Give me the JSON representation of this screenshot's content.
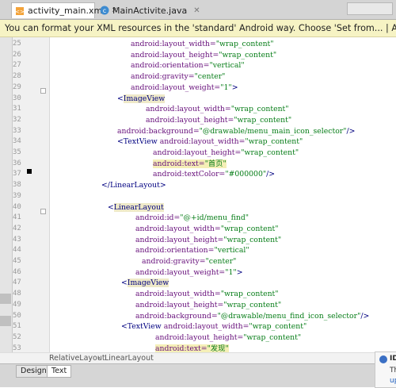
{
  "tabs": [
    {
      "label": "activity_main.xml",
      "icon": "xml-file-icon",
      "active": true
    },
    {
      "label": "MainActivite.java",
      "icon": "java-class-icon",
      "active": false
    }
  ],
  "notice": "You can format your XML resources in the 'standard' Android way. Choose 'Set from... | Android' in the XML code styl...",
  "lines": [
    {
      "n": "25",
      "indent": 165,
      "parts": [
        [
          "attr",
          "android:layout_width="
        ],
        [
          "val",
          "\"wrap_content\""
        ]
      ]
    },
    {
      "n": "26",
      "indent": 165,
      "parts": [
        [
          "attr",
          "android:layout_height="
        ],
        [
          "val",
          "\"wrap_content\""
        ]
      ]
    },
    {
      "n": "27",
      "indent": 165,
      "parts": [
        [
          "attr",
          "android:orientation="
        ],
        [
          "val",
          "\"vertical\""
        ]
      ]
    },
    {
      "n": "28",
      "indent": 165,
      "parts": [
        [
          "attr",
          "android:gravity="
        ],
        [
          "val",
          "\"center\""
        ]
      ]
    },
    {
      "n": "29",
      "indent": 165,
      "parts": [
        [
          "attr",
          "android:layout_weight="
        ],
        [
          "val",
          "\"1\""
        ],
        [
          "tag",
          ">"
        ]
      ]
    },
    {
      "n": "30",
      "indent": 148,
      "parts": [
        [
          "tag",
          "<"
        ],
        [
          "taghl",
          "ImageView"
        ]
      ]
    },
    {
      "n": "31",
      "indent": 184,
      "parts": [
        [
          "attr",
          "android:layout_width="
        ],
        [
          "val",
          "\"wrap_content\""
        ]
      ]
    },
    {
      "n": "32",
      "indent": 184,
      "parts": [
        [
          "attr",
          "android:layout_height="
        ],
        [
          "val",
          "\"wrap_content\""
        ]
      ]
    },
    {
      "n": "33",
      "indent": 148,
      "parts": [
        [
          "attr",
          "android:background="
        ],
        [
          "val",
          "\"@drawable/menu_main_icon_selector\""
        ],
        [
          "tag",
          "/>"
        ]
      ]
    },
    {
      "n": "34",
      "indent": 148,
      "parts": [
        [
          "tag",
          "<TextView "
        ],
        [
          "attr",
          "android:layout_width="
        ],
        [
          "val",
          "\"wrap_content\""
        ]
      ]
    },
    {
      "n": "35",
      "indent": 193,
      "parts": [
        [
          "attr",
          "android:layout_height="
        ],
        [
          "val",
          "\"wrap_content\""
        ]
      ]
    },
    {
      "n": "36",
      "indent": 193,
      "parts": [
        [
          "attrhl",
          "android:text="
        ],
        [
          "valhl",
          "\"首页\""
        ]
      ]
    },
    {
      "n": "37",
      "indent": 193,
      "parts": [
        [
          "attr",
          "android:textColor="
        ],
        [
          "val",
          "\"#000000\""
        ],
        [
          "tag",
          "/>"
        ]
      ]
    },
    {
      "n": "38",
      "indent": 128,
      "parts": [
        [
          "tag",
          "</"
        ],
        [
          "tag",
          "LinearLayout"
        ],
        [
          "tag",
          ">"
        ]
      ]
    },
    {
      "n": "39",
      "indent": 128,
      "parts": []
    },
    {
      "n": "40",
      "indent": 136,
      "parts": [
        [
          "tag",
          "<"
        ],
        [
          "taghl",
          "LinearLayout"
        ]
      ]
    },
    {
      "n": "41",
      "indent": 171,
      "parts": [
        [
          "attr",
          "android:id="
        ],
        [
          "val",
          "\"@+id/menu_find\""
        ]
      ]
    },
    {
      "n": "42",
      "indent": 171,
      "parts": [
        [
          "attr",
          "android:layout_width="
        ],
        [
          "val",
          "\"wrap_content\""
        ]
      ]
    },
    {
      "n": "43",
      "indent": 171,
      "parts": [
        [
          "attr",
          "android:layout_height="
        ],
        [
          "val",
          "\"wrap_content\""
        ]
      ]
    },
    {
      "n": "44",
      "indent": 171,
      "parts": [
        [
          "attr",
          "android:orientation="
        ],
        [
          "val",
          "\"vertical\""
        ]
      ]
    },
    {
      "n": "45",
      "indent": 179,
      "parts": [
        [
          "attr",
          "android:gravity="
        ],
        [
          "val",
          "\"center\""
        ]
      ]
    },
    {
      "n": "46",
      "indent": 171,
      "parts": [
        [
          "attr",
          "android:layout_weight="
        ],
        [
          "val",
          "\"1\""
        ],
        [
          "tag",
          ">"
        ]
      ]
    },
    {
      "n": "47",
      "indent": 153,
      "parts": [
        [
          "tag",
          "<"
        ],
        [
          "taghl",
          "ImageView"
        ]
      ]
    },
    {
      "n": "48",
      "indent": 171,
      "parts": [
        [
          "attr",
          "android:layout_width="
        ],
        [
          "val",
          "\"wrap_content\""
        ]
      ]
    },
    {
      "n": "49",
      "indent": 171,
      "parts": [
        [
          "attr",
          "android:layout_height="
        ],
        [
          "val",
          "\"wrap_content\""
        ]
      ]
    },
    {
      "n": "50",
      "indent": 171,
      "parts": [
        [
          "attr",
          "android:background="
        ],
        [
          "val",
          "\"@drawable/menu_find_icon_selector\""
        ],
        [
          "tag",
          "/>"
        ]
      ]
    },
    {
      "n": "51",
      "indent": 153,
      "parts": [
        [
          "tag",
          "<TextView "
        ],
        [
          "attr",
          "android:layout_width="
        ],
        [
          "val",
          "\"wrap_content\""
        ]
      ]
    },
    {
      "n": "52",
      "indent": 196,
      "parts": [
        [
          "attr",
          "android:layout_height="
        ],
        [
          "val",
          "\"wrap_content\""
        ]
      ]
    },
    {
      "n": "53",
      "indent": 196,
      "parts": [
        [
          "attrhl",
          "android:text="
        ],
        [
          "valhl",
          "\"发现\""
        ]
      ]
    }
  ],
  "breadcrumb": [
    "RelativeLayout",
    "LinearLayout"
  ],
  "bottom_tabs": [
    {
      "label": "Design",
      "active": false
    },
    {
      "label": "Text",
      "active": true
    }
  ],
  "popup": {
    "title": "ID",
    "text": "Th",
    "link": "up"
  }
}
